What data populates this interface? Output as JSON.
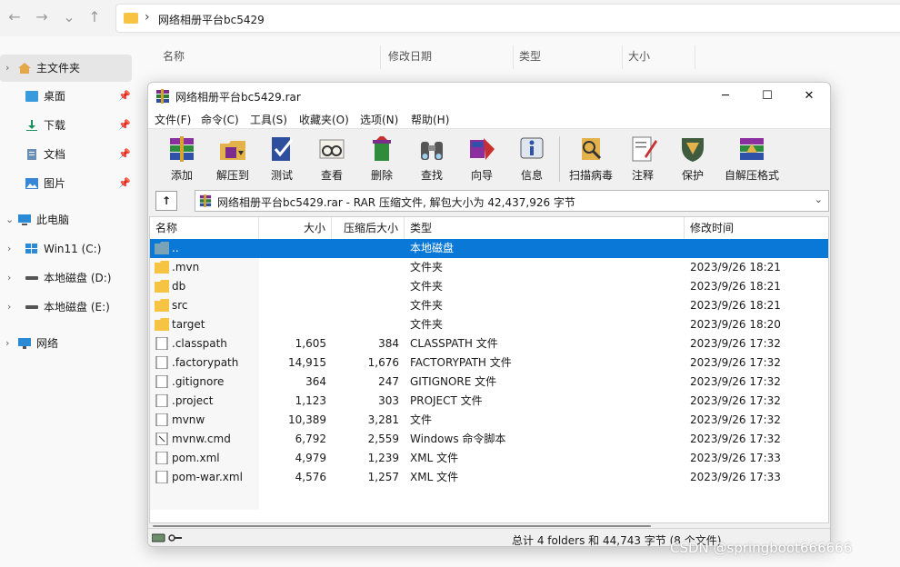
{
  "explorer": {
    "path_label": "网络相册平台bc5429",
    "columns": [
      "名称",
      "修改日期",
      "类型",
      "大小"
    ],
    "sidebar": [
      {
        "label": "主文件夹",
        "pinned": false
      },
      {
        "label": "桌面",
        "pinned": true
      },
      {
        "label": "下载",
        "pinned": true
      },
      {
        "label": "文档",
        "pinned": true
      },
      {
        "label": "图片",
        "pinned": true
      },
      {
        "label": "此电脑",
        "pinned": false
      },
      {
        "label": "Win11 (C:)",
        "pinned": false
      },
      {
        "label": "本地磁盘 (D:)",
        "pinned": false
      },
      {
        "label": "本地磁盘 (E:)",
        "pinned": false
      },
      {
        "label": "网络",
        "pinned": false
      }
    ]
  },
  "winrar": {
    "title": "网络相册平台bc5429.rar",
    "controls": {
      "minimize": "─",
      "maximize": "☐",
      "close": "✕"
    },
    "menu": [
      "文件(F)",
      "命令(C)",
      "工具(S)",
      "收藏夹(O)",
      "选项(N)",
      "帮助(H)"
    ],
    "toolbar": [
      "添加",
      "解压到",
      "测试",
      "查看",
      "删除",
      "查找",
      "向导",
      "信息",
      "扫描病毒",
      "注释",
      "保护",
      "自解压格式"
    ],
    "up_label": "↑",
    "path": "网络相册平台bc5429.rar - RAR 压缩文件, 解包大小为 42,437,926 字节",
    "dropdown": "⌄",
    "columns": {
      "name": "名称",
      "size": "大小",
      "packed": "压缩后大小",
      "type": "类型",
      "modified": "修改时间"
    },
    "rows": [
      {
        "name": "..",
        "size": "",
        "packed": "",
        "type": "本地磁盘",
        "modified": "",
        "kind": "up"
      },
      {
        "name": ".mvn",
        "size": "",
        "packed": "",
        "type": "文件夹",
        "modified": "2023/9/26 18:21",
        "kind": "folder"
      },
      {
        "name": "db",
        "size": "",
        "packed": "",
        "type": "文件夹",
        "modified": "2023/9/26 18:21",
        "kind": "folder"
      },
      {
        "name": "src",
        "size": "",
        "packed": "",
        "type": "文件夹",
        "modified": "2023/9/26 18:21",
        "kind": "folder"
      },
      {
        "name": "target",
        "size": "",
        "packed": "",
        "type": "文件夹",
        "modified": "2023/9/26 18:20",
        "kind": "folder"
      },
      {
        "name": ".classpath",
        "size": "1,605",
        "packed": "384",
        "type": "CLASSPATH 文件",
        "modified": "2023/9/26 17:32",
        "kind": "file"
      },
      {
        "name": ".factorypath",
        "size": "14,915",
        "packed": "1,676",
        "type": "FACTORYPATH 文件",
        "modified": "2023/9/26 17:32",
        "kind": "file"
      },
      {
        "name": ".gitignore",
        "size": "364",
        "packed": "247",
        "type": "GITIGNORE 文件",
        "modified": "2023/9/26 17:32",
        "kind": "file"
      },
      {
        "name": ".project",
        "size": "1,123",
        "packed": "303",
        "type": "PROJECT 文件",
        "modified": "2023/9/26 17:32",
        "kind": "file"
      },
      {
        "name": "mvnw",
        "size": "10,389",
        "packed": "3,281",
        "type": "文件",
        "modified": "2023/9/26 17:32",
        "kind": "file"
      },
      {
        "name": "mvnw.cmd",
        "size": "6,792",
        "packed": "2,559",
        "type": "Windows 命令脚本",
        "modified": "2023/9/26 17:32",
        "kind": "cmd"
      },
      {
        "name": "pom.xml",
        "size": "4,979",
        "packed": "1,239",
        "type": "XML 文件",
        "modified": "2023/9/26 17:33",
        "kind": "file"
      },
      {
        "name": "pom-war.xml",
        "size": "4,576",
        "packed": "1,257",
        "type": "XML 文件",
        "modified": "2023/9/26 17:33",
        "kind": "file"
      }
    ],
    "status": "总计 4 folders 和 44,743 字节 (8 个文件)",
    "colors": {
      "selection": "#0a78d7",
      "folder": "#f6c343"
    }
  },
  "watermark": "CSDN @springboot666666"
}
